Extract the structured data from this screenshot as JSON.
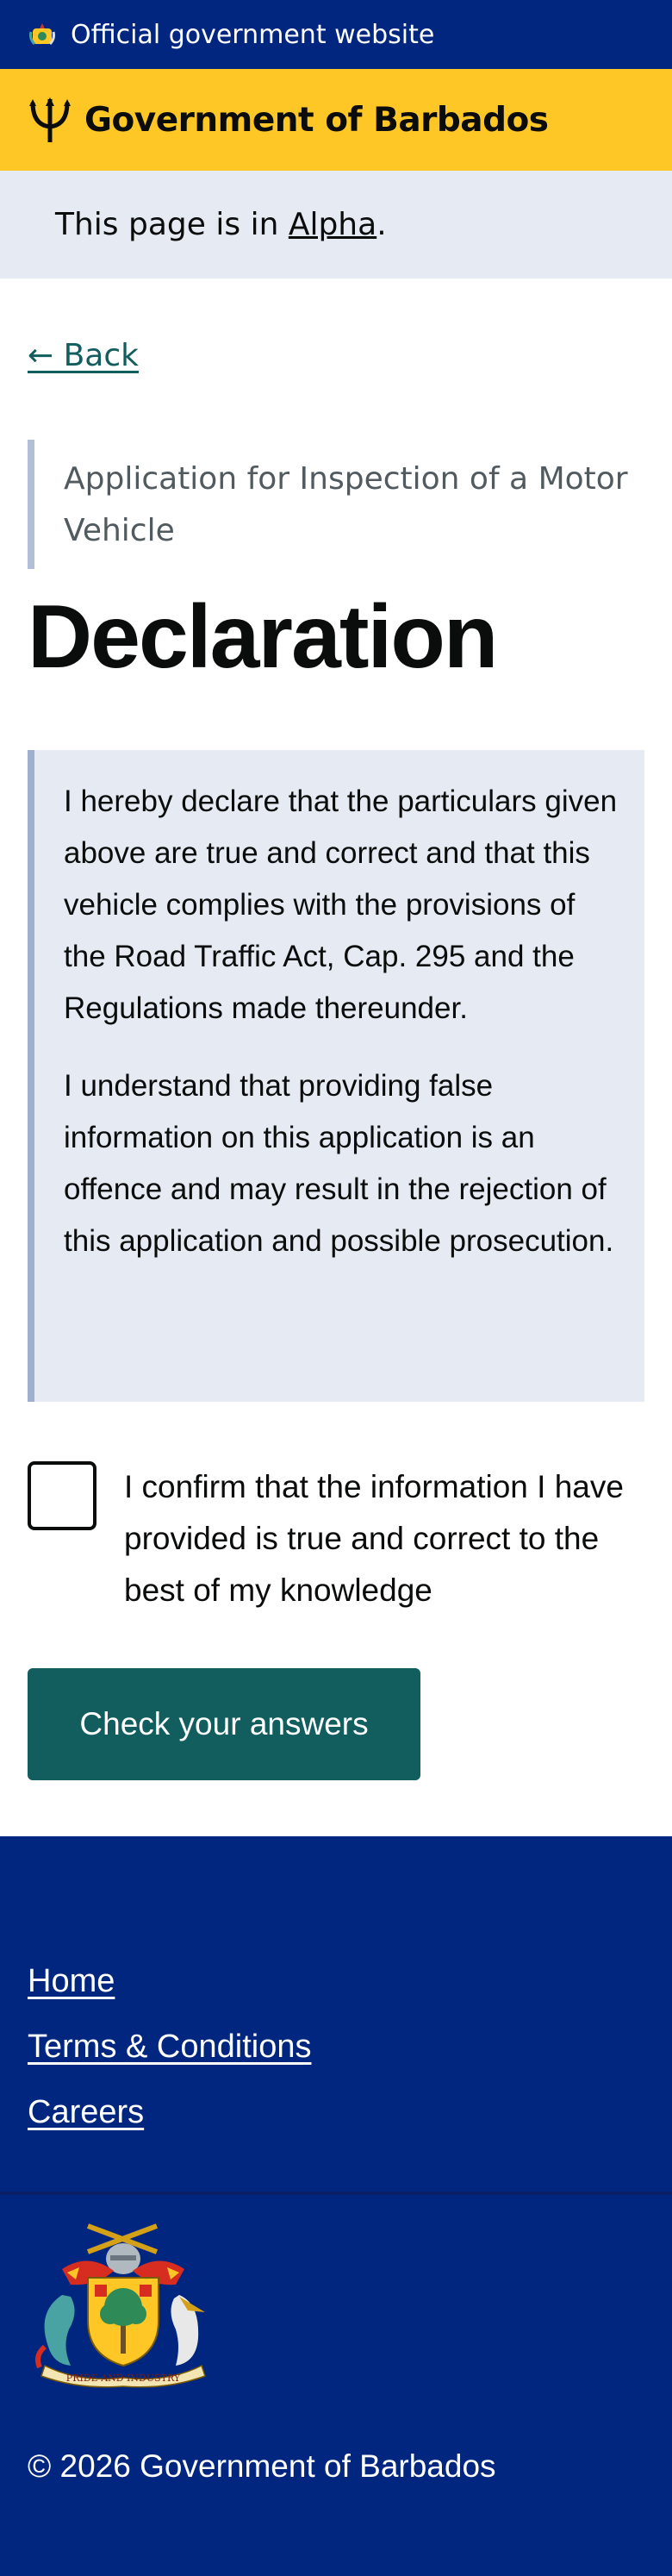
{
  "banner": {
    "official_text": "Official government website",
    "crest_icon": "barbados-crest-icon"
  },
  "header": {
    "title": "Government of Barbados",
    "logo_icon": "trident-icon",
    "background_color": "#ffc726"
  },
  "phase_banner": {
    "prefix": "This page is in ",
    "phase": "Alpha",
    "suffix": "."
  },
  "back_link": "← Back",
  "caption": "Application for Inspection of a Motor Vehicle",
  "title": "Declaration",
  "inset": {
    "paragraphs": [
      "I hereby declare that the particulars given above are true and correct and that this vehicle complies with the provisions of the Road Traffic Act, Cap. 295 and the Regulations made thereunder.",
      "I understand that providing false information on this application is an offence and may result in the rejection of this application and possible prosecution."
    ]
  },
  "confirm_checkbox": {
    "label": "I confirm that the information I have provided is true and correct to the best of my knowledge",
    "checked": false
  },
  "submit_button": "Check your answers",
  "footer": {
    "links": [
      "Home",
      "Terms & Conditions",
      "Careers"
    ],
    "coat_of_arms_icon": "coat-of-arms-icon",
    "motto": "PRIDE AND INDUSTRY",
    "copyright": "© 2026 Government of Barbados"
  },
  "colors": {
    "brand_blue": "#00267f",
    "brand_yellow": "#ffc726",
    "accent_teal": "#125e5e",
    "inset_background": "#e5eaf3"
  }
}
